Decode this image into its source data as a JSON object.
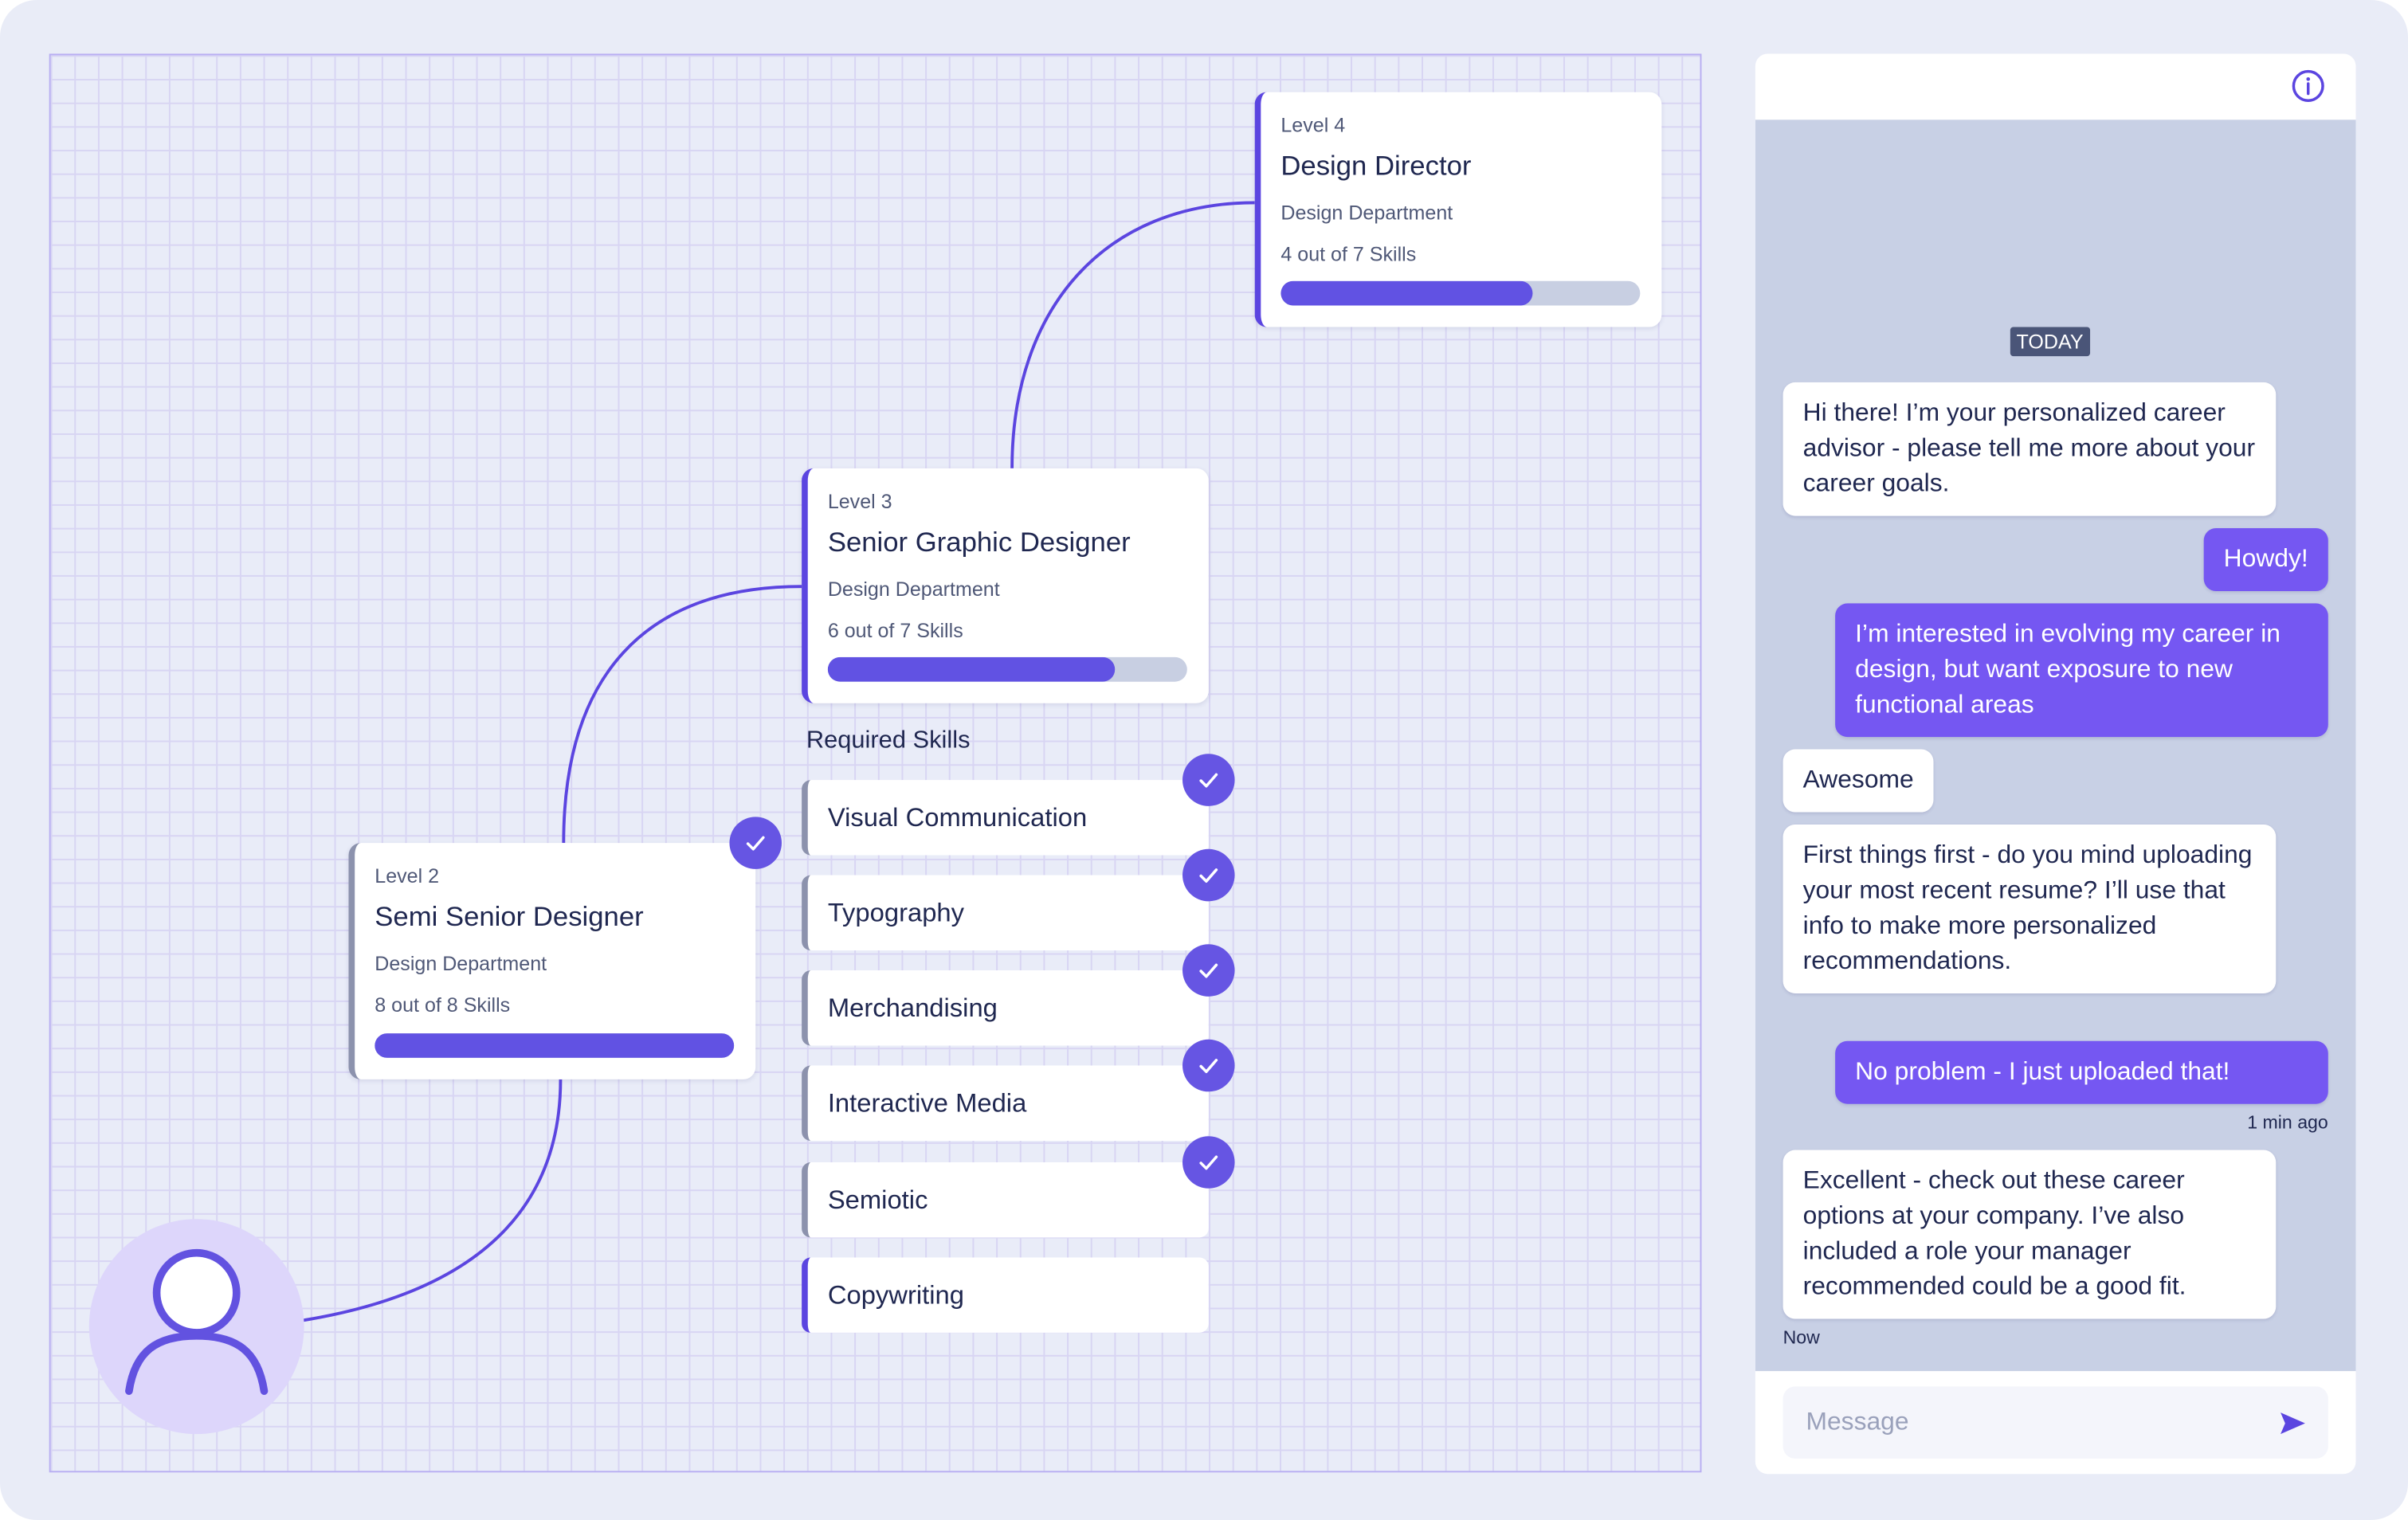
{
  "colors": {
    "accent": "#5b45e0",
    "user_bubble": "#7557f2",
    "chat_bg": "#c8d0e5",
    "progress_track": "#c8cfe2"
  },
  "career_path": {
    "cards": [
      {
        "level": "Level 4",
        "title": "Design Director",
        "department": "Design Department",
        "skills_text": "4 out of 7 Skills",
        "progress": 0.7
      },
      {
        "level": "Level 3",
        "title": "Senior Graphic Designer",
        "department": "Design Department",
        "skills_text": "6 out of 7 Skills",
        "progress": 0.8
      },
      {
        "level": "Level 2",
        "title": "Semi Senior Designer",
        "department": "Design Department",
        "skills_text": "8 out of 8 Skills",
        "progress": 1.0,
        "completed": true
      }
    ],
    "required_skills_label": "Required Skills",
    "skills": [
      {
        "name": "Visual Communication",
        "checked": true
      },
      {
        "name": "Typography",
        "checked": true
      },
      {
        "name": "Merchandising",
        "checked": true
      },
      {
        "name": "Interactive Media",
        "checked": true
      },
      {
        "name": "Semiotic",
        "checked": true
      },
      {
        "name": "Copywriting",
        "checked": false
      }
    ],
    "avatar_icon": "user-icon"
  },
  "chat": {
    "header_icon": "info-icon",
    "date_label": "TODAY",
    "messages": [
      {
        "from": "bot",
        "text": "Hi there! I’m your personalized career advisor - please tell me more about your career goals."
      },
      {
        "from": "user",
        "text": "Howdy!"
      },
      {
        "from": "user",
        "text": "I’m interested in evolving my career in design, but want exposure to new functional areas"
      },
      {
        "from": "bot",
        "text": "Awesome"
      },
      {
        "from": "bot",
        "text": "First things first - do you mind uploading your most recent resume? I’ll use that info to make more personalized recommendations."
      },
      {
        "from": "user",
        "text": "No problem - I just uploaded that!"
      },
      {
        "from": "bot",
        "text": "Excellent - check out these career options at your company. I’ve also included a role your manager recommended could be a good fit."
      }
    ],
    "timestamps": {
      "user_last": "1 min ago",
      "bot_last": "Now"
    },
    "input": {
      "placeholder": "Message",
      "value": ""
    },
    "send_icon": "send-icon"
  }
}
